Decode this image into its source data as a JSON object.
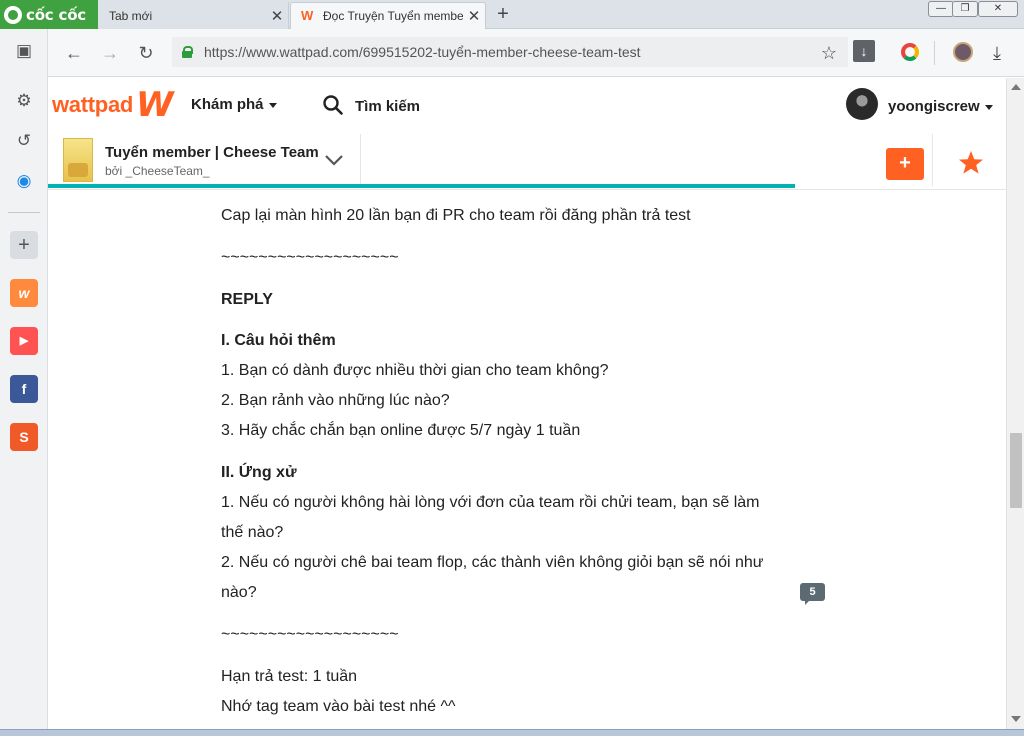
{
  "browser": {
    "name": "cốc cốc",
    "tabs": [
      {
        "title": "Tab mới",
        "active": false
      },
      {
        "title": "Đọc Truyện Tuyển membe",
        "active": true
      }
    ],
    "url": "https://www.wattpad.com/699515202-tuyển-member-cheese-team-test",
    "window_controls": {
      "minimize": "—",
      "maximize": "❐",
      "close": "✕"
    }
  },
  "sidebar": {
    "icons": [
      "tablet-icon",
      "gear-icon",
      "history-icon",
      "messenger-icon",
      "add-icon",
      "wattpad-icon",
      "youtube-icon",
      "facebook-icon",
      "shopee-icon"
    ]
  },
  "header": {
    "logo": "wattpad",
    "discover_label": "Khám phá",
    "search_label": "Tìm kiếm",
    "username": "yoongiscrew"
  },
  "story": {
    "title": "Tuyển member | Cheese Team",
    "author": "bởi _CheeseTeam_",
    "add_label": "+",
    "reading_progress": 0.78
  },
  "content": {
    "paragraphs": [
      {
        "text": "Cap lại màn hình 20 lần bạn đi PR cho team rồi đăng phần trả test",
        "bold": false
      },
      {
        "text": "~~~~~~~~~~~~~~~~~~~",
        "bold": false
      },
      {
        "text": "REPLY",
        "bold": true
      },
      {
        "text": "I. Câu hỏi thêm",
        "bold": true
      },
      {
        "text": "1. Bạn có dành được nhiều thời gian cho team không?",
        "bold": false
      },
      {
        "text": "2. Bạn rảnh vào những lúc nào?",
        "bold": false
      },
      {
        "text": "3. Hãy chắc chắn bạn online được 5/7 ngày 1 tuần",
        "bold": false
      },
      {
        "text": "II. Ứng xử",
        "bold": true
      },
      {
        "text": "1. Nếu có người không hài lòng với đơn của team rồi chửi team, bạn sẽ làm",
        "bold": false
      },
      {
        "text": "thế nào?",
        "bold": false
      },
      {
        "text": "2. Nếu có người chê bai team flop, các thành viên không giỏi bạn sẽ nói như",
        "bold": false
      },
      {
        "text": "nào?",
        "bold": false
      },
      {
        "text": "~~~~~~~~~~~~~~~~~~~",
        "bold": false
      },
      {
        "text": "Hạn trả test: 1 tuần",
        "bold": false
      },
      {
        "text": "Nhớ tag team vào bài test nhé ^^",
        "bold": false
      }
    ],
    "comment_count": "5"
  },
  "colors": {
    "wattpad_orange": "#ff6122",
    "progress_teal": "#00b2b2",
    "coccoc_green": "#3fa140"
  }
}
